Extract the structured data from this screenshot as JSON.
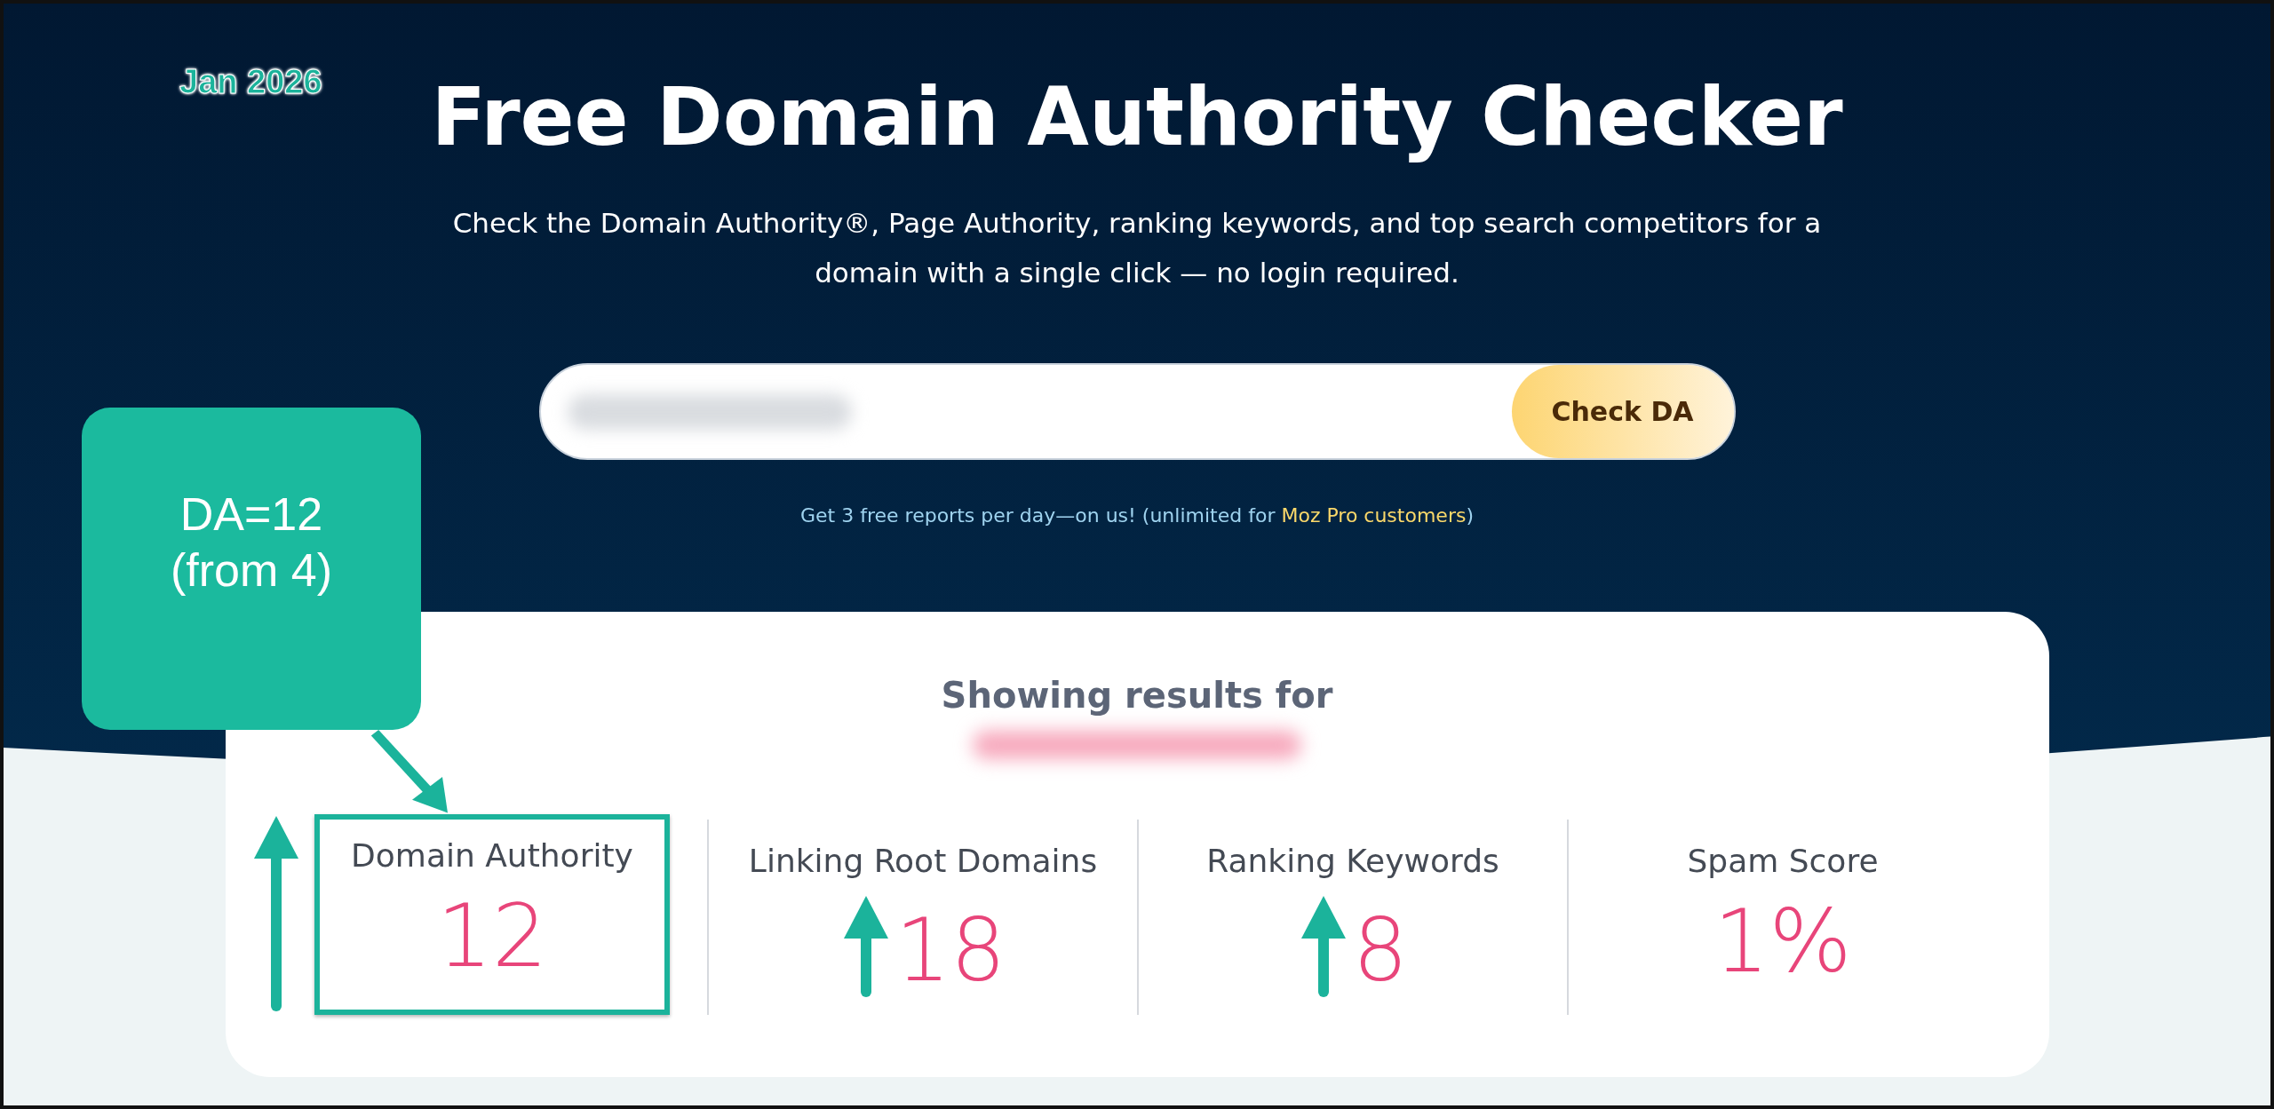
{
  "badge": "Jan 2026",
  "title": "Free Domain Authority Checker",
  "subtitle": "Check the Domain Authority®, Page Authority, ranking keywords, and top search competitors for a domain with a single click — no login required.",
  "search": {
    "button": "Check DA"
  },
  "note": {
    "text": "Get 3 free reports per day—on us! (unlimited for ",
    "link": "Moz Pro customers",
    "tail": ")"
  },
  "results": {
    "heading": "Showing results for",
    "metrics": [
      {
        "label": "Domain Authority",
        "value": "12",
        "highlighted": true,
        "up_arrow": true
      },
      {
        "label": "Linking Root Domains",
        "value": "18",
        "highlighted": false,
        "up_arrow": true
      },
      {
        "label": "Ranking Keywords",
        "value": "8",
        "highlighted": false,
        "up_arrow": true
      },
      {
        "label": "Spam Score",
        "value": "1%",
        "highlighted": false,
        "up_arrow": false
      }
    ]
  },
  "callout": {
    "lines": [
      "DA=12",
      "(from 4)"
    ]
  }
}
